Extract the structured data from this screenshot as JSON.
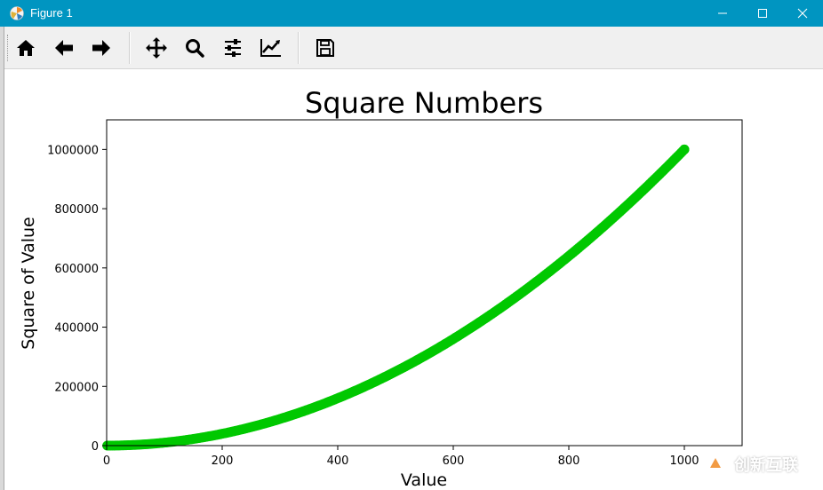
{
  "window": {
    "title": "Figure 1"
  },
  "toolbar": {
    "buttons": [
      {
        "name": "home-button",
        "icon": "home-icon"
      },
      {
        "name": "back-button",
        "icon": "arrow-left-icon"
      },
      {
        "name": "forward-button",
        "icon": "arrow-right-icon"
      },
      {
        "name": "pan-button",
        "icon": "move-icon"
      },
      {
        "name": "zoom-button",
        "icon": "search-icon"
      },
      {
        "name": "configure-subplots-button",
        "icon": "sliders-icon"
      },
      {
        "name": "edit-axes-button",
        "icon": "line-chart-icon"
      },
      {
        "name": "save-button",
        "icon": "floppy-disk-icon"
      }
    ]
  },
  "chart_data": {
    "type": "scatter",
    "title": "Square Numbers",
    "xlabel": "Value",
    "ylabel": "Square of Value",
    "x_range": [
      1,
      1000
    ],
    "y_formula": "x^2",
    "xlim": [
      0,
      1100
    ],
    "ylim": [
      0,
      1100000
    ],
    "xticks": [
      0,
      200,
      400,
      600,
      800,
      1000
    ],
    "yticks": [
      0,
      200000,
      400000,
      600000,
      800000,
      1000000
    ],
    "xtick_labels": [
      "0",
      "200",
      "400",
      "600",
      "800",
      "1000"
    ],
    "ytick_labels": [
      "0",
      "200000",
      "400000",
      "600000",
      "800000",
      "1000000"
    ],
    "series": [
      {
        "color": "#00c800",
        "points": [
          [
            1,
            1
          ],
          [
            50,
            2500
          ],
          [
            100,
            10000
          ],
          [
            150,
            22500
          ],
          [
            200,
            40000
          ],
          [
            250,
            62500
          ],
          [
            300,
            90000
          ],
          [
            350,
            122500
          ],
          [
            400,
            160000
          ],
          [
            450,
            202500
          ],
          [
            500,
            250000
          ],
          [
            550,
            302500
          ],
          [
            600,
            360000
          ],
          [
            650,
            422500
          ],
          [
            700,
            490000
          ],
          [
            750,
            562500
          ],
          [
            800,
            640000
          ],
          [
            850,
            722500
          ],
          [
            900,
            810000
          ],
          [
            950,
            902500
          ],
          [
            1000,
            1000000
          ]
        ]
      }
    ],
    "grid": false,
    "legend": false
  },
  "watermark": {
    "text": "创新互联"
  }
}
